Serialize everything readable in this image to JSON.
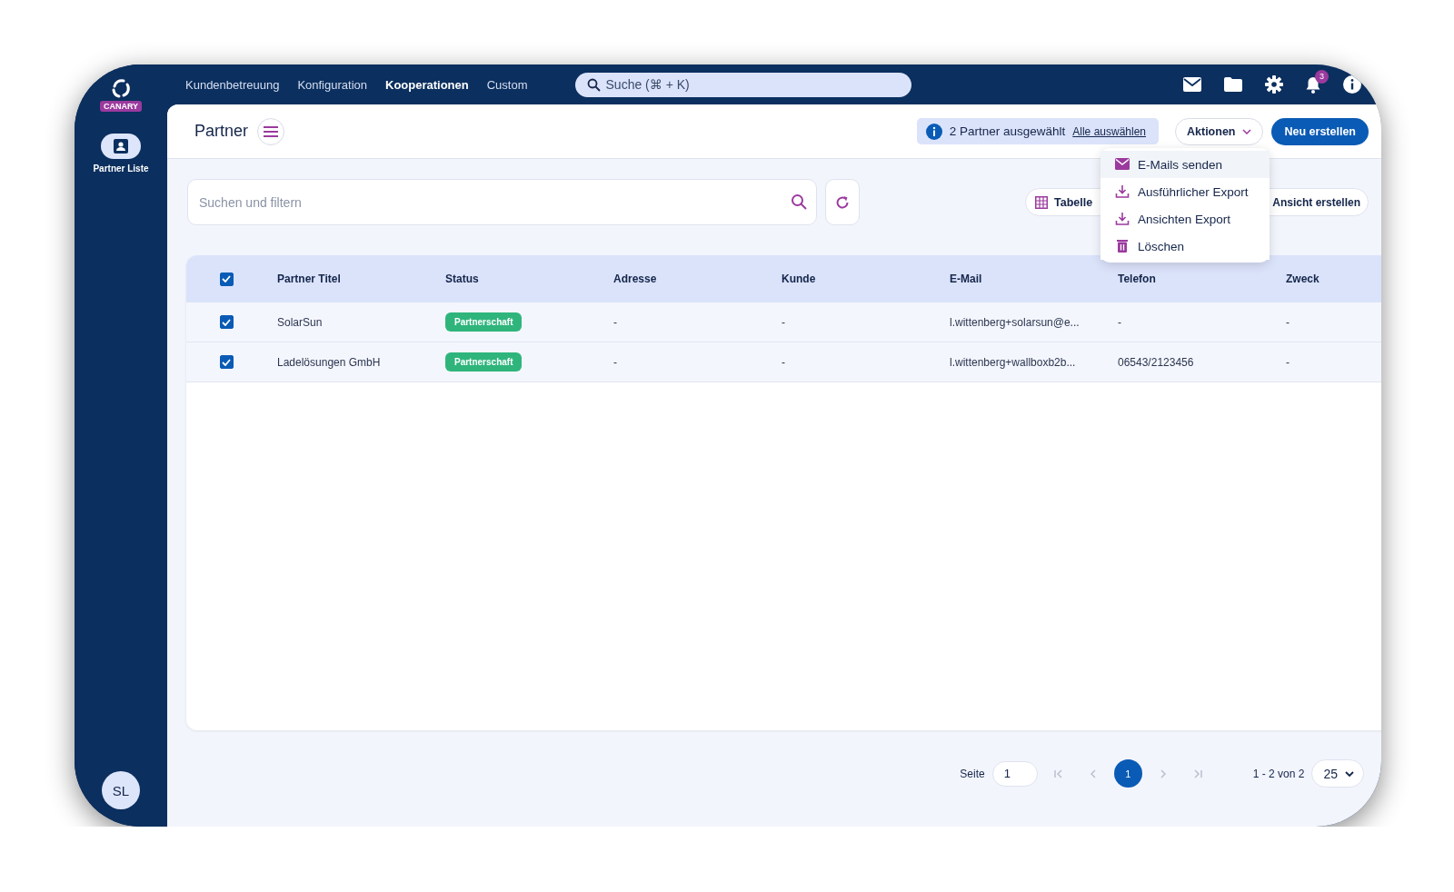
{
  "brand": {
    "label": "CANARY"
  },
  "sidebar": {
    "items": [
      {
        "label": "Partner Liste",
        "selected": true
      }
    ],
    "avatar": "SL"
  },
  "top_nav": {
    "items": [
      {
        "label": "Kundenbetreuung",
        "selected": false
      },
      {
        "label": "Konfiguration",
        "selected": false
      },
      {
        "label": "Kooperationen",
        "selected": true
      },
      {
        "label": "Custom",
        "selected": false
      }
    ],
    "search": {
      "placeholder": "Suche (⌘ + K)"
    },
    "notification_count": "3"
  },
  "header": {
    "title": "Partner",
    "selection_info": "2 Partner ausgewählt",
    "select_all_link": "Alle auswählen",
    "actions_button": "Aktionen",
    "create_button": "Neu erstellen"
  },
  "actions_menu": {
    "items": [
      {
        "label": "E-Mails senden",
        "kind": "mail",
        "selected": true
      },
      {
        "label": "Ausführlicher Export",
        "kind": "download",
        "selected": false
      },
      {
        "label": "Ansichten Export",
        "kind": "download",
        "selected": false
      },
      {
        "label": "Löschen",
        "kind": "delete",
        "selected": false
      }
    ]
  },
  "toolbar": {
    "search": {
      "placeholder": "Suchen und filtern"
    },
    "view_button": "Tabelle",
    "create_view_button": "Ansicht erstellen"
  },
  "table": {
    "all_checked": true,
    "columns": [
      "Partner Titel",
      "Status",
      "Adresse",
      "Kunde",
      "E-Mail",
      "Telefon",
      "Zweck"
    ],
    "rows": [
      {
        "checked": true,
        "title": "SolarSun",
        "status": "Partnerschaft",
        "address": "-",
        "customer": "-",
        "email": "l.wittenberg+solarsun@e...",
        "phone": "-",
        "purpose": "-"
      },
      {
        "checked": true,
        "title": "Ladelösungen GmbH",
        "status": "Partnerschaft",
        "address": "-",
        "customer": "-",
        "email": "l.wittenberg+wallboxb2b...",
        "phone": "06543/2123456",
        "purpose": "-"
      }
    ]
  },
  "pagination": {
    "page_label": "Seite",
    "page_value": "1",
    "first_disabled": true,
    "prev_disabled": true,
    "next_disabled": true,
    "last_disabled": true,
    "pages": [
      {
        "label": "1",
        "selected": true
      }
    ],
    "range": "1 - 2 von 2",
    "page_size": "25"
  }
}
